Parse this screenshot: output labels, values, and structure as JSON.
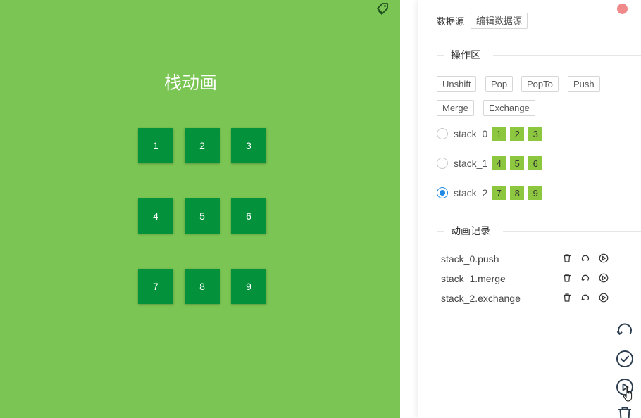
{
  "stage": {
    "title": "栈动画",
    "background": "#7ac553",
    "tile_color": "#03913b",
    "icon": "tag-icon",
    "tiles": [
      "1",
      "2",
      "3",
      "4",
      "5",
      "6",
      "7",
      "8",
      "9"
    ]
  },
  "panel": {
    "datasource_label": "数据源",
    "edit_datasource_button": "编辑数据源",
    "operations_title": "操作区",
    "operations": [
      "Unshift",
      "Pop",
      "PopTo",
      "Push",
      "Merge",
      "Exchange"
    ],
    "stacks": [
      {
        "name": "stack_0",
        "items": [
          "1",
          "2",
          "3"
        ],
        "selected": false
      },
      {
        "name": "stack_1",
        "items": [
          "4",
          "5",
          "6"
        ],
        "selected": false
      },
      {
        "name": "stack_2",
        "items": [
          "7",
          "8",
          "9"
        ],
        "selected": true
      }
    ],
    "records_title": "动画记录",
    "records": [
      {
        "label": "stack_0.push",
        "icons": [
          "trash-icon",
          "undo-icon",
          "play-icon"
        ]
      },
      {
        "label": "stack_1.merge",
        "icons": [
          "trash-icon",
          "undo-icon",
          "play-icon"
        ]
      },
      {
        "label": "stack_2.exchange",
        "icons": [
          "trash-icon",
          "undo-icon",
          "play-icon"
        ]
      }
    ],
    "actions": [
      "refresh-icon",
      "confirm-icon",
      "play-icon",
      "trash-icon"
    ],
    "accent": "#1e88e5",
    "chip_color": "#8dc63f",
    "close_color": "#f08a8a"
  }
}
